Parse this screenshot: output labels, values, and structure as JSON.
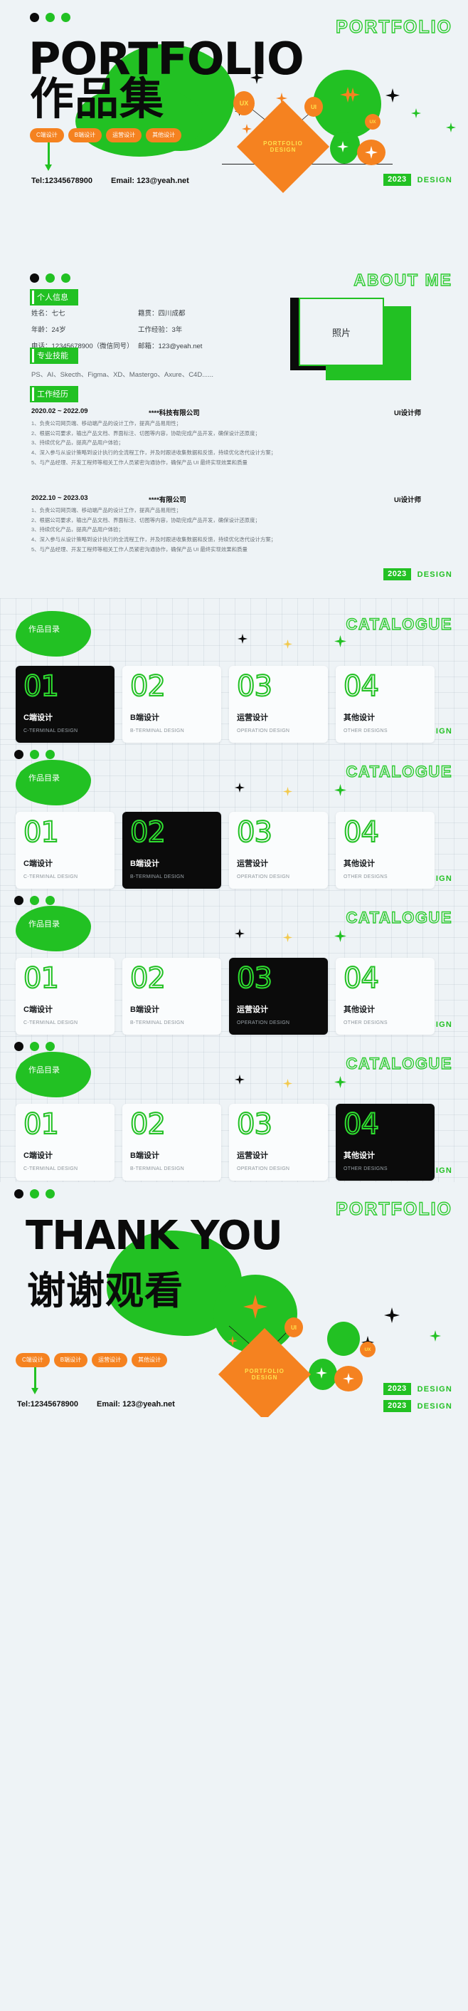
{
  "brand": {
    "portfolio_label": "PORTFOLIO",
    "about_label": "ABOUT ME",
    "catalogue_label": "CATALOGUE",
    "year": "2023",
    "design": "DESIGN",
    "accent_green": "#22c123",
    "accent_orange": "#f58220",
    "accent_yellow": "#ffe14d",
    "bg": "#eef3f6",
    "ink": "#0b0b0b"
  },
  "cover": {
    "title_en": "PORTFOLIO",
    "title_cn": "作品集",
    "tags": [
      "C端设计",
      "B端设计",
      "运营设计",
      "其他设计"
    ],
    "tel": "Tel:12345678900",
    "email": "Email: 123@yeah.net",
    "sticker_badges": [
      "UX",
      "UI",
      "UX"
    ],
    "diamond_text": "PORTFOLIO\nDESIGN"
  },
  "about": {
    "heading": "ABOUT ME",
    "section_personal": "个人信息",
    "section_skills": "专业技能",
    "section_experience": "工作经历",
    "info": [
      {
        "label": "姓名：",
        "value": "七七",
        "label2": "籍贯：",
        "value2": "四川成都"
      },
      {
        "label": "年龄：",
        "value": "24岁",
        "label2": "工作经验：",
        "value2": "3年"
      },
      {
        "label": "电话：",
        "value": "12345678900（微信同号）",
        "label2": "邮箱：",
        "value2": "123@yeah.net"
      }
    ],
    "info_rows": [
      "姓名：七七",
      "年龄：24岁",
      "电话：12345678900（微信同号）"
    ],
    "info_rows_right": [
      "籍贯：四川成都",
      "工作经验：3年",
      "邮箱：123@yeah.net"
    ],
    "skills": "PS、AI、Skecth、Figma、XD、Mastergo、Axure、C4D......",
    "photo_placeholder": "照片",
    "jobs": [
      {
        "date": "2020.02 ~ 2022.09",
        "company": "****科技有限公司",
        "role": "UI设计师",
        "bullets": [
          "1、负责公司网页端、移动端产品的设计工作，提高产品易用性；",
          "2、根据公司要求，输出产品文档、界面标注、切图等内容，协助完成产品开发，确保设计还原度；",
          "3、持续优化产品，提高产品用户体验；",
          "4、深入参与从设计策略到设计执行的全流程工作，并及时跟进收集数据和反馈，持续优化迭代设计方案；",
          "5、与产品经理、开发工程师等相关工作人员紧密沟通协作，确保产品 UI 最终实现效果和质量"
        ]
      },
      {
        "date": "2022.10 ~ 2023.03",
        "company": "****有限公司",
        "role": "Ui设计师",
        "bullets": [
          "1、负责公司网页端、移动端产品的设计工作，提高产品易用性；",
          "2、根据公司要求，输出产品文档、界面标注、切图等内容，协助完成产品开发，确保设计还原度；",
          "3、持续优化产品，提高产品用户体验；",
          "4、深入参与从设计策略到设计执行的全流程工作，并及时跟进收集数据和反馈，持续优化迭代设计方案；",
          "5、与产品经理、开发工程师等相关工作人员紧密沟通协作，确保产品 UI 最终实现效果和质量"
        ]
      }
    ]
  },
  "catalogue": {
    "pill": "作品目录",
    "word": "CATALOGUE",
    "cards": [
      {
        "num": "01",
        "cn": "C端设计",
        "en": "C-TERMINAL DESIGN"
      },
      {
        "num": "02",
        "cn": "B端设计",
        "en": "B-TERMINAL DESIGN"
      },
      {
        "num": "03",
        "cn": "运营设计",
        "en": "OPERATION DESIGN"
      },
      {
        "num": "04",
        "cn": "其他设计",
        "en": "OTHER DESIGNS"
      }
    ],
    "active_indexes": [
      0,
      1,
      2,
      3
    ]
  },
  "thanks": {
    "corner": "PORTFOLIO",
    "title_en": "THANK YOU",
    "title_cn": "谢谢观看",
    "tags": [
      "C端设计",
      "B端设计",
      "运营设计",
      "其他设计"
    ],
    "tel": "Tel:12345678900",
    "email": "Email: 123@yeah.net",
    "sticker_badges": [
      "UX",
      "UI",
      "UX"
    ],
    "diamond_text": "PORTFOLIO\nDESIGN"
  }
}
